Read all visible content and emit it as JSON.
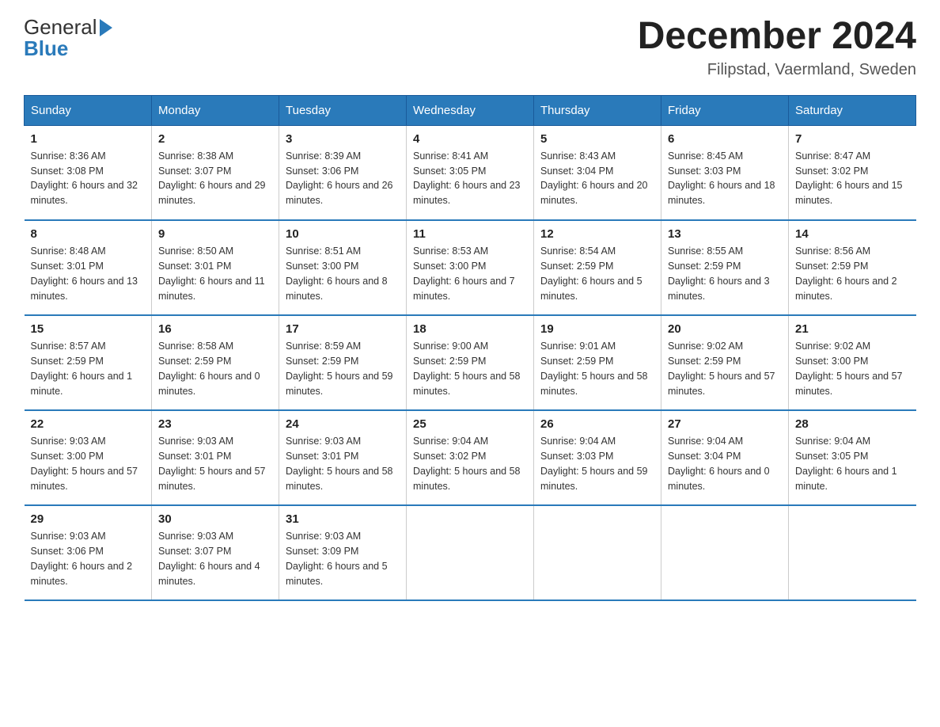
{
  "header": {
    "logo_general": "General",
    "logo_blue": "Blue",
    "month_title": "December 2024",
    "location": "Filipstad, Vaermland, Sweden"
  },
  "days_of_week": [
    "Sunday",
    "Monday",
    "Tuesday",
    "Wednesday",
    "Thursday",
    "Friday",
    "Saturday"
  ],
  "weeks": [
    [
      {
        "day": "1",
        "sunrise": "8:36 AM",
        "sunset": "3:08 PM",
        "daylight": "6 hours and 32 minutes."
      },
      {
        "day": "2",
        "sunrise": "8:38 AM",
        "sunset": "3:07 PM",
        "daylight": "6 hours and 29 minutes."
      },
      {
        "day": "3",
        "sunrise": "8:39 AM",
        "sunset": "3:06 PM",
        "daylight": "6 hours and 26 minutes."
      },
      {
        "day": "4",
        "sunrise": "8:41 AM",
        "sunset": "3:05 PM",
        "daylight": "6 hours and 23 minutes."
      },
      {
        "day": "5",
        "sunrise": "8:43 AM",
        "sunset": "3:04 PM",
        "daylight": "6 hours and 20 minutes."
      },
      {
        "day": "6",
        "sunrise": "8:45 AM",
        "sunset": "3:03 PM",
        "daylight": "6 hours and 18 minutes."
      },
      {
        "day": "7",
        "sunrise": "8:47 AM",
        "sunset": "3:02 PM",
        "daylight": "6 hours and 15 minutes."
      }
    ],
    [
      {
        "day": "8",
        "sunrise": "8:48 AM",
        "sunset": "3:01 PM",
        "daylight": "6 hours and 13 minutes."
      },
      {
        "day": "9",
        "sunrise": "8:50 AM",
        "sunset": "3:01 PM",
        "daylight": "6 hours and 11 minutes."
      },
      {
        "day": "10",
        "sunrise": "8:51 AM",
        "sunset": "3:00 PM",
        "daylight": "6 hours and 8 minutes."
      },
      {
        "day": "11",
        "sunrise": "8:53 AM",
        "sunset": "3:00 PM",
        "daylight": "6 hours and 7 minutes."
      },
      {
        "day": "12",
        "sunrise": "8:54 AM",
        "sunset": "2:59 PM",
        "daylight": "6 hours and 5 minutes."
      },
      {
        "day": "13",
        "sunrise": "8:55 AM",
        "sunset": "2:59 PM",
        "daylight": "6 hours and 3 minutes."
      },
      {
        "day": "14",
        "sunrise": "8:56 AM",
        "sunset": "2:59 PM",
        "daylight": "6 hours and 2 minutes."
      }
    ],
    [
      {
        "day": "15",
        "sunrise": "8:57 AM",
        "sunset": "2:59 PM",
        "daylight": "6 hours and 1 minute."
      },
      {
        "day": "16",
        "sunrise": "8:58 AM",
        "sunset": "2:59 PM",
        "daylight": "6 hours and 0 minutes."
      },
      {
        "day": "17",
        "sunrise": "8:59 AM",
        "sunset": "2:59 PM",
        "daylight": "5 hours and 59 minutes."
      },
      {
        "day": "18",
        "sunrise": "9:00 AM",
        "sunset": "2:59 PM",
        "daylight": "5 hours and 58 minutes."
      },
      {
        "day": "19",
        "sunrise": "9:01 AM",
        "sunset": "2:59 PM",
        "daylight": "5 hours and 58 minutes."
      },
      {
        "day": "20",
        "sunrise": "9:02 AM",
        "sunset": "2:59 PM",
        "daylight": "5 hours and 57 minutes."
      },
      {
        "day": "21",
        "sunrise": "9:02 AM",
        "sunset": "3:00 PM",
        "daylight": "5 hours and 57 minutes."
      }
    ],
    [
      {
        "day": "22",
        "sunrise": "9:03 AM",
        "sunset": "3:00 PM",
        "daylight": "5 hours and 57 minutes."
      },
      {
        "day": "23",
        "sunrise": "9:03 AM",
        "sunset": "3:01 PM",
        "daylight": "5 hours and 57 minutes."
      },
      {
        "day": "24",
        "sunrise": "9:03 AM",
        "sunset": "3:01 PM",
        "daylight": "5 hours and 58 minutes."
      },
      {
        "day": "25",
        "sunrise": "9:04 AM",
        "sunset": "3:02 PM",
        "daylight": "5 hours and 58 minutes."
      },
      {
        "day": "26",
        "sunrise": "9:04 AM",
        "sunset": "3:03 PM",
        "daylight": "5 hours and 59 minutes."
      },
      {
        "day": "27",
        "sunrise": "9:04 AM",
        "sunset": "3:04 PM",
        "daylight": "6 hours and 0 minutes."
      },
      {
        "day": "28",
        "sunrise": "9:04 AM",
        "sunset": "3:05 PM",
        "daylight": "6 hours and 1 minute."
      }
    ],
    [
      {
        "day": "29",
        "sunrise": "9:03 AM",
        "sunset": "3:06 PM",
        "daylight": "6 hours and 2 minutes."
      },
      {
        "day": "30",
        "sunrise": "9:03 AM",
        "sunset": "3:07 PM",
        "daylight": "6 hours and 4 minutes."
      },
      {
        "day": "31",
        "sunrise": "9:03 AM",
        "sunset": "3:09 PM",
        "daylight": "6 hours and 5 minutes."
      },
      null,
      null,
      null,
      null
    ]
  ],
  "labels": {
    "sunrise": "Sunrise:",
    "sunset": "Sunset:",
    "daylight": "Daylight:"
  }
}
